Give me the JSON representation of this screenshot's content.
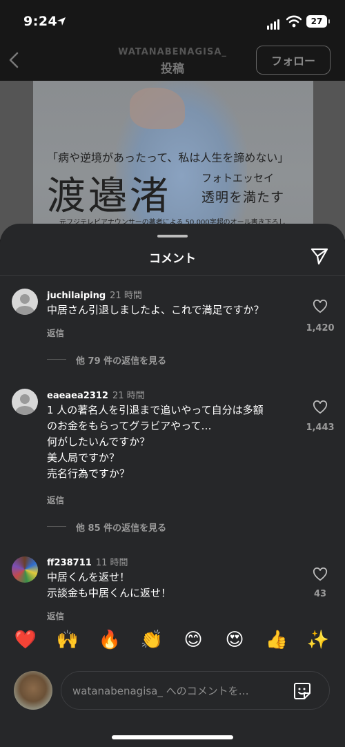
{
  "status": {
    "time": "9:24",
    "battery": "27"
  },
  "header": {
    "username": "WATANABENAGISA_",
    "title": "投稿",
    "follow_label": "フォロー"
  },
  "photo": {
    "quote": "「病や逆境があったって、私は人生を諦めない」",
    "title": "渡邉渚",
    "subtitle1": "フォトエッセイ",
    "subtitle2": "透明を満たす",
    "line": "元フジテレビアナウンサーの著者による 50,000字超のオール書き下ろし"
  },
  "sheet": {
    "title": "コメント"
  },
  "comments": [
    {
      "user": "juchilaiping",
      "time": "21 時間",
      "lines": [
        "中居さん引退しましたよ、これで満足ですか？"
      ],
      "reply": "返信",
      "likes": "1,420",
      "more": "他 79 件の返信を見る"
    },
    {
      "user": "eaeaea2312",
      "time": "21 時間",
      "lines": [
        "1 人の著名人を引退まで追いやって自分は多額",
        "のお金をもらってグラビアやって…",
        "何がしたいんですか？",
        "美人局ですか？",
        "売名行為ですか？"
      ],
      "reply": "返信",
      "likes": "1,443",
      "more": "他 85 件の返信を見る"
    },
    {
      "user": "ff238711",
      "time": "11 時間",
      "lines": [
        "中居くんを返せ！",
        "示談金も中居くんに返せ！"
      ],
      "reply": "返信",
      "likes": "43"
    }
  ],
  "emojis": [
    "❤️",
    "🙌",
    "🔥",
    "👏",
    "😊",
    "😍",
    "👍",
    "✨"
  ],
  "composer": {
    "placeholder": "watanabenagisa_ へのコメントを…"
  },
  "icons": {
    "back": "chevron-left-icon",
    "send": "send-icon",
    "heart": "heart-outline-icon",
    "sticker": "sticker-icon"
  }
}
